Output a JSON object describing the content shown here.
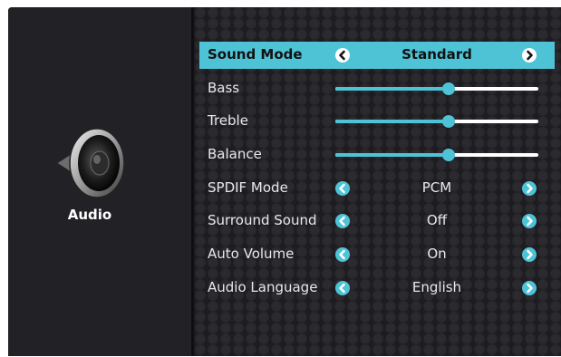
{
  "section": {
    "label": "Audio",
    "icon": "speaker-icon"
  },
  "colors": {
    "accent": "#4fc3d6",
    "panel": "#222125",
    "text": "#e8e8ea"
  },
  "settings": [
    {
      "label": "Sound Mode",
      "type": "selector",
      "value": "Standard",
      "selected": true
    },
    {
      "label": "Bass",
      "type": "slider",
      "level": 0.56
    },
    {
      "label": "Treble",
      "type": "slider",
      "level": 0.56
    },
    {
      "label": "Balance",
      "type": "slider",
      "level": 0.56
    },
    {
      "label": "SPDIF Mode",
      "type": "selector",
      "value": "PCM"
    },
    {
      "label": "Surround Sound",
      "type": "selector",
      "value": "Off"
    },
    {
      "label": "Auto Volume",
      "type": "selector",
      "value": "On"
    },
    {
      "label": "Audio Language",
      "type": "selector",
      "value": "English"
    }
  ]
}
